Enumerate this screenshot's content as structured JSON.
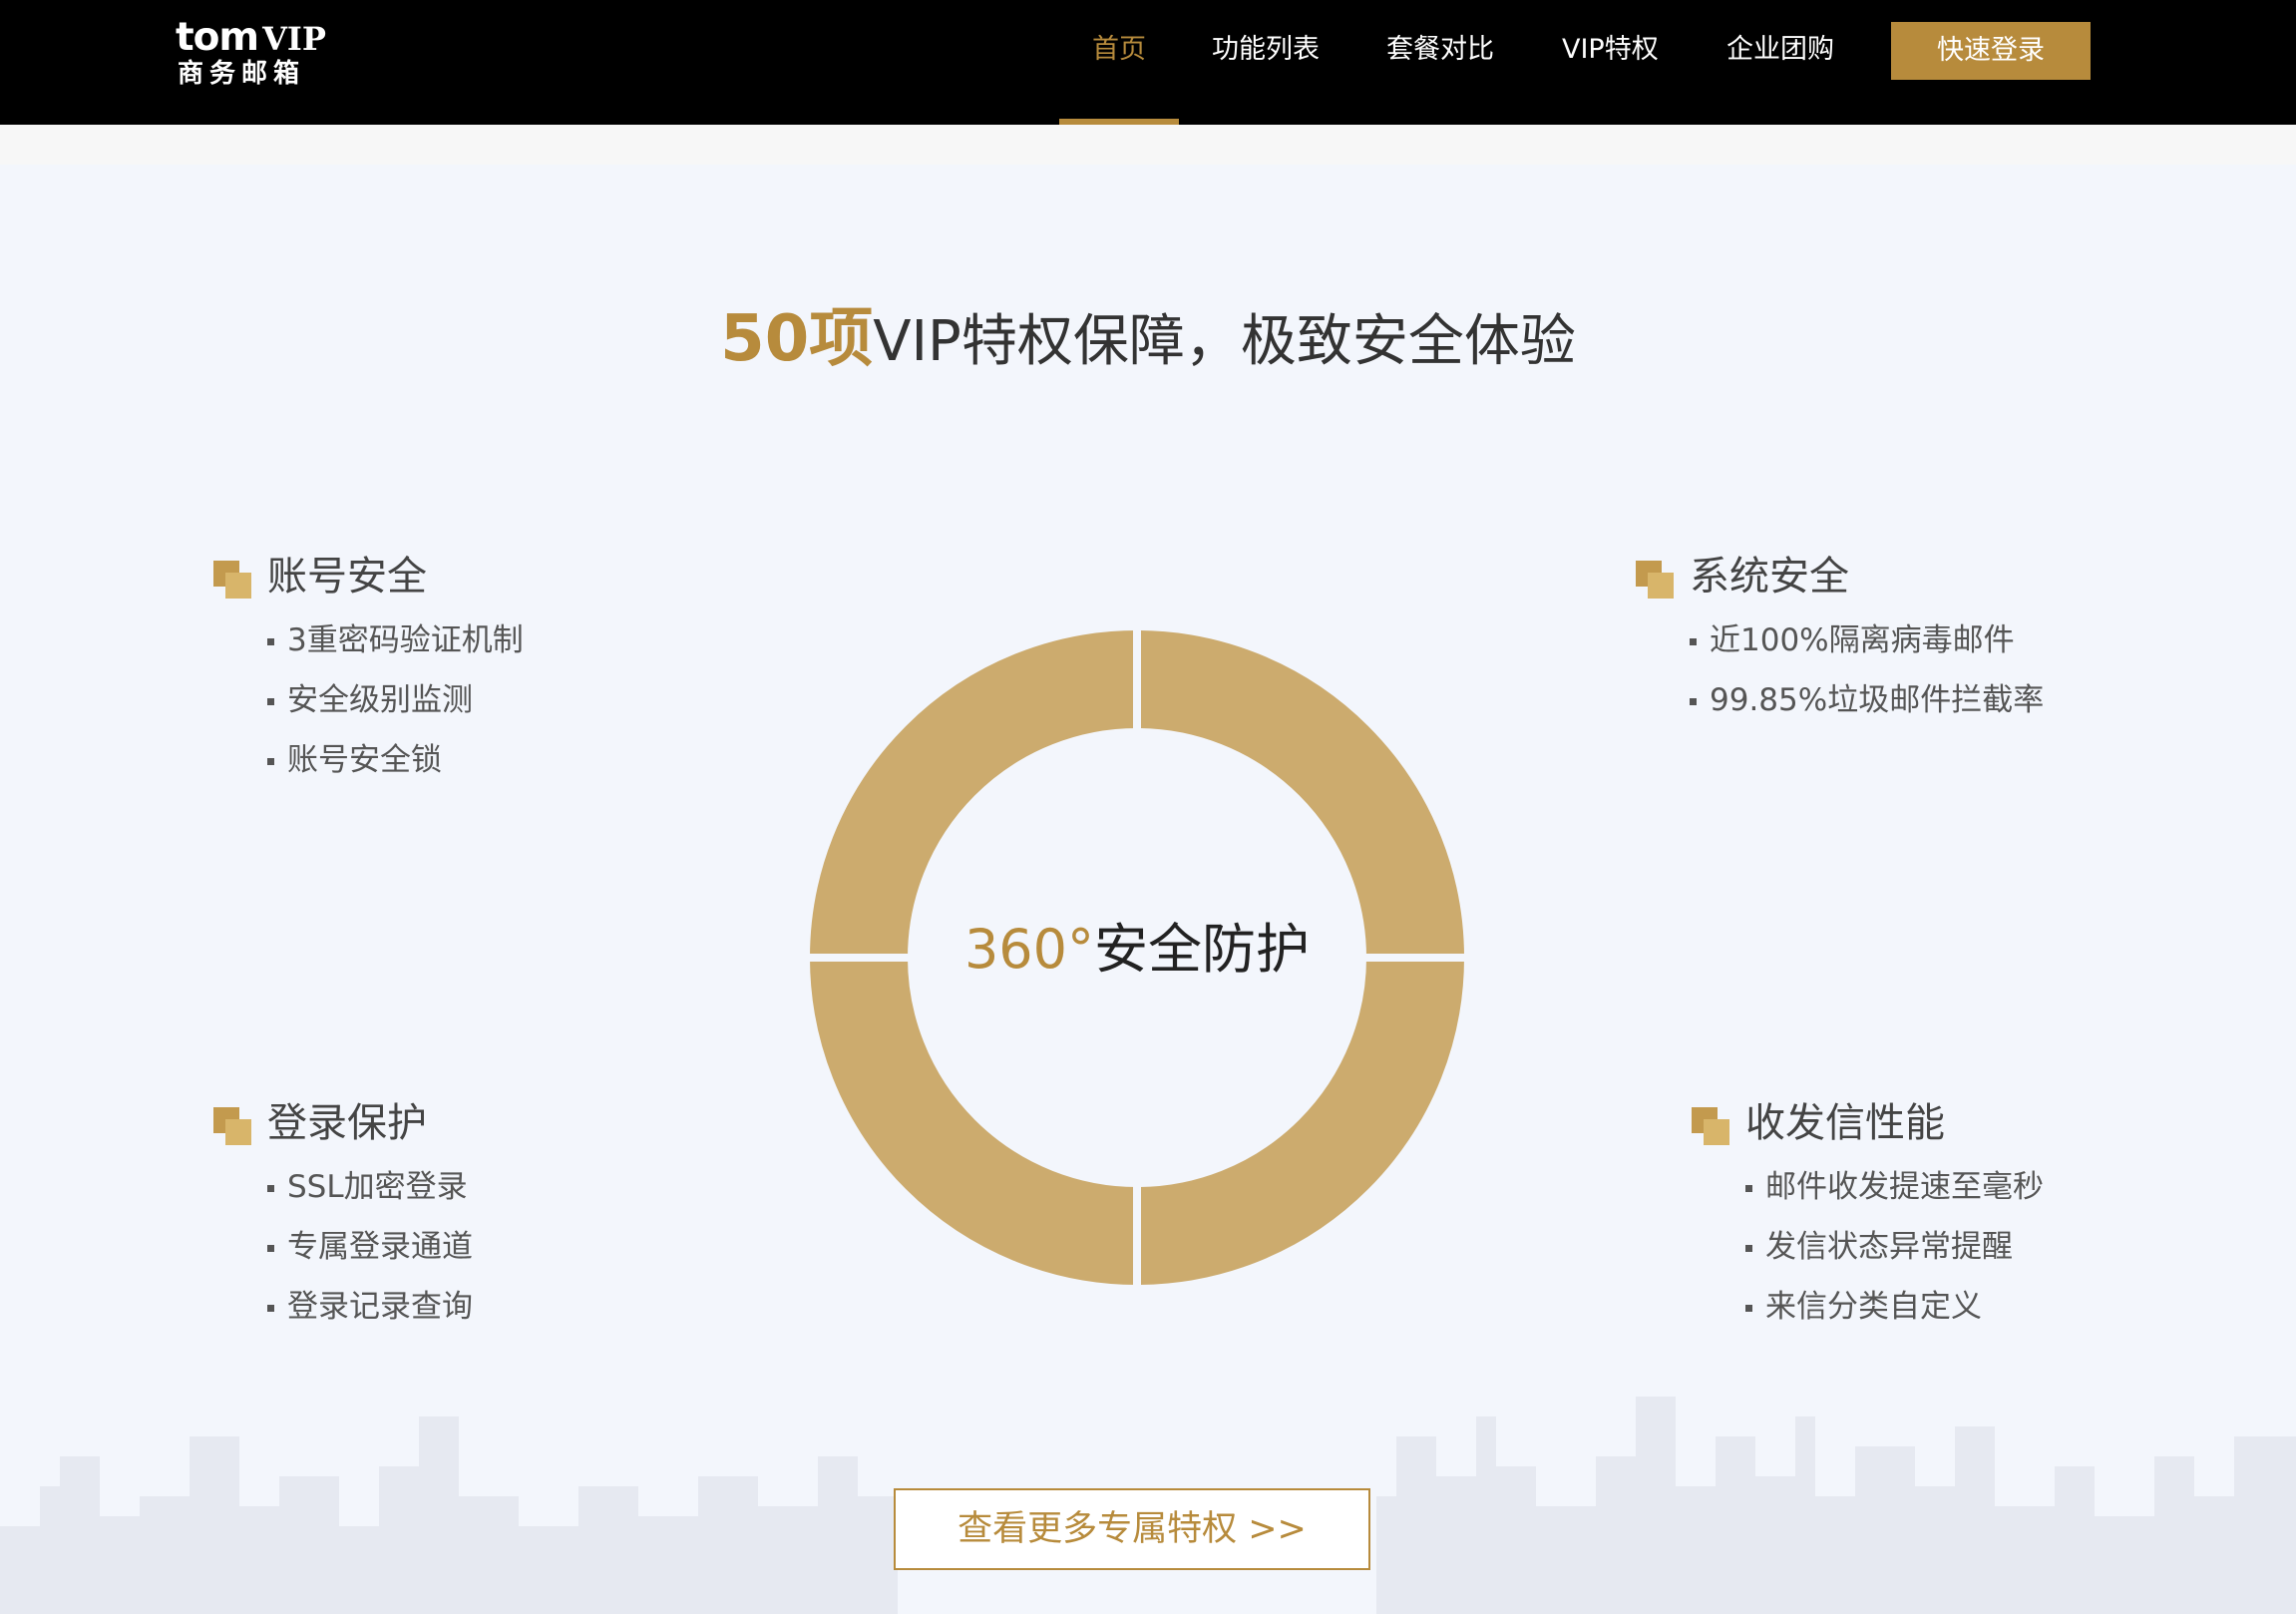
{
  "header": {
    "logo_brand": "tom",
    "logo_vip": "VIP",
    "logo_sub": "商务邮箱",
    "nav": [
      {
        "label": "首页"
      },
      {
        "label": "功能列表"
      },
      {
        "label": "套餐对比"
      },
      {
        "label": "VIP特权"
      },
      {
        "label": "企业团购"
      }
    ],
    "login_label": "快速登录",
    "accent_color": "#b78b3c"
  },
  "main": {
    "title_accent": "50项",
    "title_rest": "VIP特权保障，极致安全体验",
    "ring": {
      "center_degree": "360°",
      "center_text": "安全防护",
      "color": "#ccab6e"
    },
    "features": [
      {
        "title": "账号安全",
        "items": [
          "3重密码验证机制",
          "安全级别监测",
          "账号安全锁"
        ]
      },
      {
        "title": "系统安全",
        "items": [
          "近100%隔离病毒邮件",
          "99.85%垃圾邮件拦截率"
        ]
      },
      {
        "title": "登录保护",
        "items": [
          "SSL加密登录",
          "专属登录通道",
          "登录记录查询"
        ]
      },
      {
        "title": "收发信性能",
        "items": [
          "邮件收发提速至毫秒",
          "发信状态异常提醒",
          "来信分类自定义"
        ]
      }
    ],
    "more_label": "查看更多专属特权 >>"
  }
}
